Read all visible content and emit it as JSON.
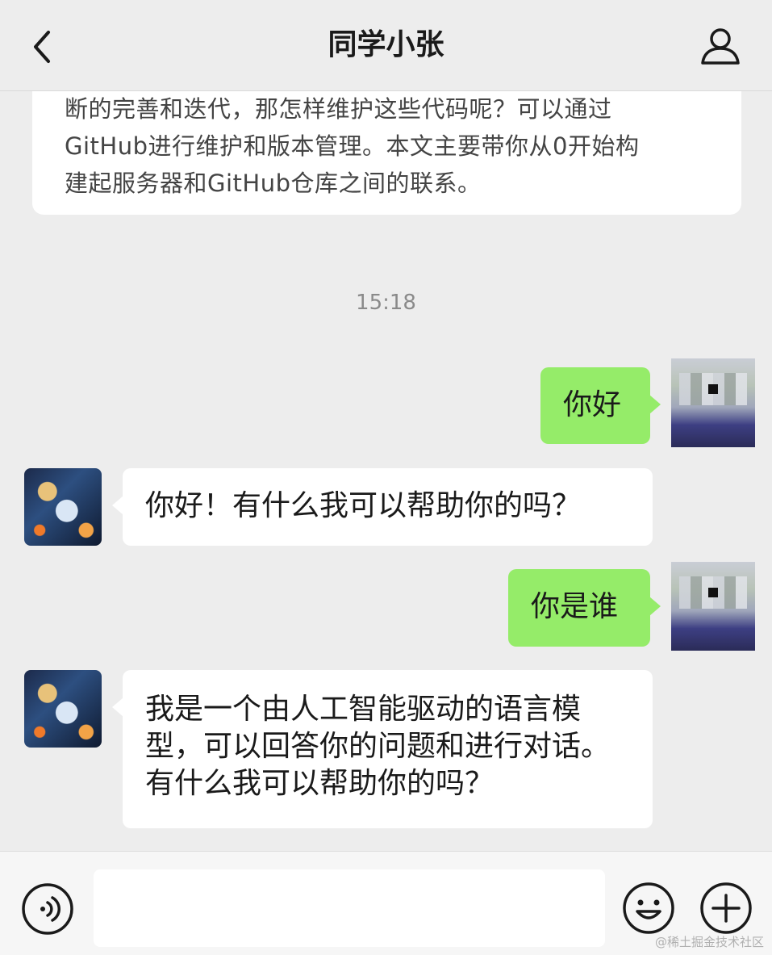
{
  "header": {
    "title": "同学小张",
    "back_icon": "chevron-left-icon",
    "profile_icon": "user-icon"
  },
  "chat": {
    "article_card": {
      "lines": [
        "断的完善和迭代，那怎样维护这些代码呢？可以通过",
        "GitHub进行维护和版本管理。本文主要带你从0开始构",
        "建起服务器和GitHub仓库之间的联系。"
      ]
    },
    "timestamp": "15:18",
    "messages": [
      {
        "side": "out",
        "text": "你好"
      },
      {
        "side": "in",
        "text": "你好！有什么我可以帮助你的吗？"
      },
      {
        "side": "out",
        "text": "你是谁"
      },
      {
        "side": "in",
        "lines": [
          "我是一个由人工智能驱动的语言模",
          "型，可以回答你的问题和进行对话。",
          "有什么我可以帮助你的吗？"
        ]
      }
    ]
  },
  "input_bar": {
    "voice_icon": "voice-icon",
    "emoji_icon": "emoji-icon",
    "plus_icon": "plus-icon",
    "text_value": ""
  },
  "watermark": "@稀土掘金技术社区",
  "colors": {
    "background": "#ededed",
    "outgoing_bubble": "#95ec69",
    "incoming_bubble": "#ffffff"
  }
}
